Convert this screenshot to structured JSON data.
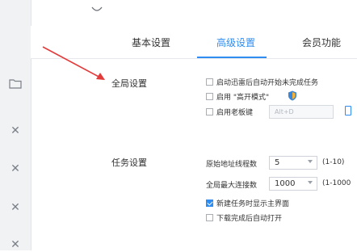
{
  "tabs": [
    {
      "label": "基本设置"
    },
    {
      "label": "高级设置"
    },
    {
      "label": "会员功能"
    }
  ],
  "accent_color": "#2f8cf0",
  "annotation_color": "#e23b3b",
  "global": {
    "label": "全局设置",
    "options": [
      {
        "label": "启动迅雷后自动开始未完成任务",
        "checked": false
      },
      {
        "label": "启用 \"高开模式\"",
        "checked": false
      },
      {
        "label": "启用老板键",
        "checked": false
      }
    ],
    "hotkey_placeholder": "Alt+D",
    "shield_icon": "shield-icon"
  },
  "task": {
    "label": "任务设置",
    "thread_label": "原始地址线程数",
    "thread_value": "5",
    "thread_range": "(1-10)",
    "conn_label": "全局最大连接数",
    "conn_value": "1000",
    "conn_range": "(1-1000",
    "options": [
      {
        "label": "新建任务时显示主界面",
        "checked": true
      },
      {
        "label": "下载完成后自动打开",
        "checked": false
      }
    ]
  }
}
